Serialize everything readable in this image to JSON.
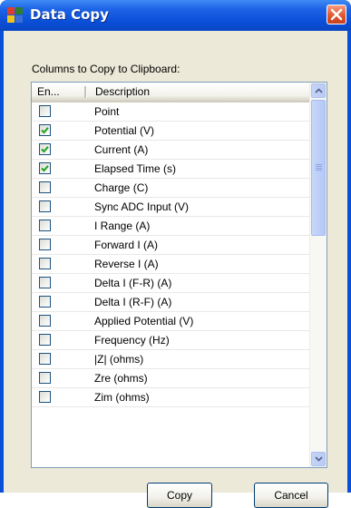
{
  "window": {
    "title": "Data Copy",
    "icon": "app-window-icon",
    "close_icon": "close-icon"
  },
  "section_label": "Columns to Copy to Clipboard:",
  "columns": {
    "enabled": "En...",
    "description": "Description"
  },
  "rows": [
    {
      "label": "Point",
      "checked": false
    },
    {
      "label": "Potential (V)",
      "checked": true
    },
    {
      "label": "Current (A)",
      "checked": true
    },
    {
      "label": "Elapsed Time (s)",
      "checked": true
    },
    {
      "label": "Charge (C)",
      "checked": false
    },
    {
      "label": "Sync ADC Input (V)",
      "checked": false
    },
    {
      "label": "I Range (A)",
      "checked": false
    },
    {
      "label": "Forward I (A)",
      "checked": false
    },
    {
      "label": "Reverse I (A)",
      "checked": false
    },
    {
      "label": "Delta I (F-R) (A)",
      "checked": false
    },
    {
      "label": "Delta I (R-F) (A)",
      "checked": false
    },
    {
      "label": "Applied Potential (V)",
      "checked": false
    },
    {
      "label": "Frequency (Hz)",
      "checked": false
    },
    {
      "label": "|Z| (ohms)",
      "checked": false
    },
    {
      "label": "Zre (ohms)",
      "checked": false
    },
    {
      "label": "Zim (ohms)",
      "checked": false
    }
  ],
  "buttons": {
    "copy": "Copy",
    "cancel": "Cancel"
  },
  "colors": {
    "titlebar": "#0a4fd8",
    "dialog_bg": "#ece9d8",
    "close_button": "#e2572f",
    "checkmark": "#21a121"
  }
}
